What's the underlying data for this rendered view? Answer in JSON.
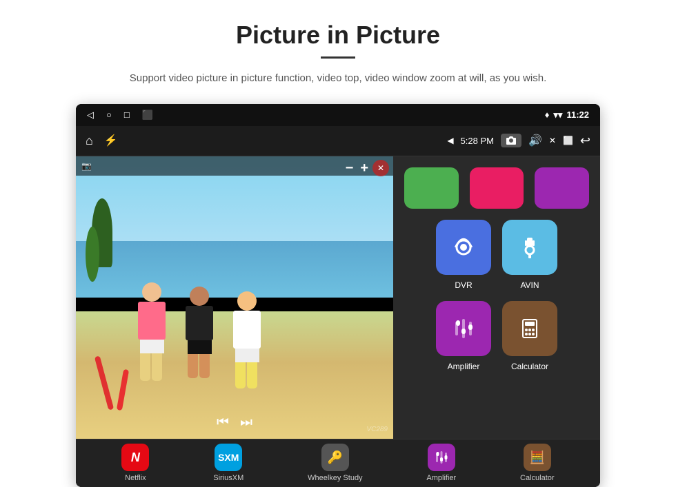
{
  "header": {
    "title": "Picture in Picture",
    "divider": true,
    "subtitle": "Support video picture in picture function, video top, video window zoom at will, as you wish."
  },
  "statusBar": {
    "back_icon": "◁",
    "home_icon": "○",
    "recent_icon": "□",
    "screenshot_icon": "⬛",
    "wifi_icon": "▾",
    "signal_icon": "▾",
    "time": "11:22"
  },
  "appBar": {
    "home_icon": "⌂",
    "usb_icon": "⚡",
    "wifi_label": "◀",
    "time": "5:28 PM",
    "camera_icon": "📷",
    "volume_icon": "🔊",
    "close_icon": "✕",
    "window_icon": "⬜",
    "back_icon": "↩"
  },
  "pip": {
    "pip_icon": "🎬",
    "minus": "−",
    "plus": "+",
    "close": "✕",
    "play_back": "⏮",
    "play_fwd": "⏭"
  },
  "apps": {
    "top_row_colors": [
      "#4caf50",
      "#e91e63",
      "#9c27b0"
    ],
    "row1": [
      {
        "id": "dvr",
        "label": "DVR",
        "bg_color": "#4a6fe0",
        "icon": "📡"
      },
      {
        "id": "avin",
        "label": "AVIN",
        "bg_color": "#5bbce4",
        "icon": "🔌"
      }
    ],
    "row2": [
      {
        "id": "amplifier",
        "label": "Amplifier",
        "bg_color": "#9c27b0",
        "icon": "🎚"
      },
      {
        "id": "calculator",
        "label": "Calculator",
        "bg_color": "#7a5230",
        "icon": "🧮"
      }
    ]
  },
  "bottomBar": {
    "items": [
      {
        "id": "netflix",
        "label": "Netflix",
        "bg": "#e50914",
        "icon": "N"
      },
      {
        "id": "siriusxm",
        "label": "SiriusXM",
        "bg": "#00a0e0",
        "icon": "S"
      },
      {
        "id": "wheelkey",
        "label": "Wheelkey Study",
        "bg": "#555",
        "icon": "🔑"
      },
      {
        "id": "amplifier",
        "label": "Amplifier",
        "bg": "#9c27b0",
        "icon": "🎚"
      },
      {
        "id": "calculator",
        "label": "Calculator",
        "bg": "#7a5230",
        "icon": "🧮"
      }
    ]
  },
  "watermark": "VC289"
}
